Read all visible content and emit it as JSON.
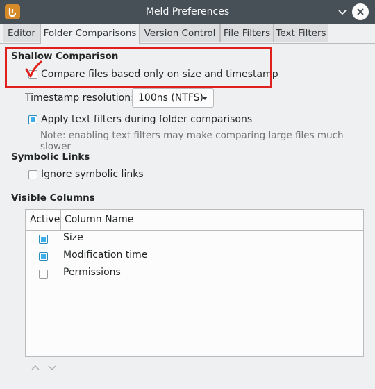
{
  "window": {
    "title": "Meld Preferences"
  },
  "tabs": [
    {
      "label": "Editor",
      "active": false
    },
    {
      "label": "Folder Comparisons",
      "active": true
    },
    {
      "label": "Version Control",
      "active": false
    },
    {
      "label": "File Filters",
      "active": false
    },
    {
      "label": "Text Filters",
      "active": false
    }
  ],
  "shallow": {
    "title": "Shallow Comparison",
    "compare_label": "Compare files based only on size and timestamp",
    "compare_checked": false,
    "timestamp_label": "Timestamp resolution:",
    "timestamp_value": "100ns (NTFS)",
    "apply_filters_label": "Apply text filters during folder comparisons",
    "apply_filters_checked": true,
    "note": "Note: enabling text filters may make comparing large files much slower"
  },
  "symlinks": {
    "title": "Symbolic Links",
    "ignore_label": "Ignore symbolic links",
    "ignore_checked": false
  },
  "columns": {
    "title": "Visible Columns",
    "header_active": "Active",
    "header_name": "Column Name",
    "rows": [
      {
        "name": "Size",
        "active": true
      },
      {
        "name": "Modification time",
        "active": true
      },
      {
        "name": "Permissions",
        "active": false
      }
    ]
  },
  "colors": {
    "accent": "#3daee9",
    "annotation": "#e0201d",
    "titlebar": "#475057"
  },
  "icons": [
    "meld-app-icon",
    "minimize-icon",
    "close-icon",
    "chevron-down-icon",
    "move-up-icon",
    "move-down-icon"
  ]
}
